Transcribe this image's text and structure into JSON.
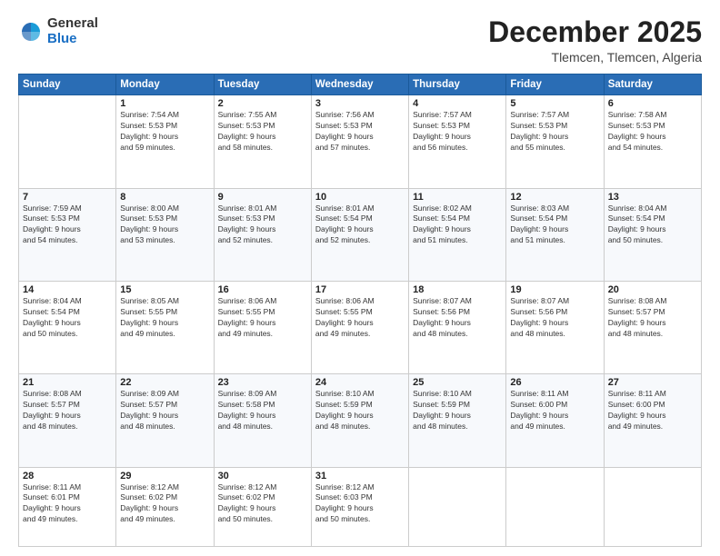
{
  "logo": {
    "general": "General",
    "blue": "Blue"
  },
  "title": {
    "month": "December 2025",
    "location": "Tlemcen, Tlemcen, Algeria"
  },
  "weekdays": [
    "Sunday",
    "Monday",
    "Tuesday",
    "Wednesday",
    "Thursday",
    "Friday",
    "Saturday"
  ],
  "weeks": [
    [
      {
        "day": "",
        "info": ""
      },
      {
        "day": "1",
        "info": "Sunrise: 7:54 AM\nSunset: 5:53 PM\nDaylight: 9 hours\nand 59 minutes."
      },
      {
        "day": "2",
        "info": "Sunrise: 7:55 AM\nSunset: 5:53 PM\nDaylight: 9 hours\nand 58 minutes."
      },
      {
        "day": "3",
        "info": "Sunrise: 7:56 AM\nSunset: 5:53 PM\nDaylight: 9 hours\nand 57 minutes."
      },
      {
        "day": "4",
        "info": "Sunrise: 7:57 AM\nSunset: 5:53 PM\nDaylight: 9 hours\nand 56 minutes."
      },
      {
        "day": "5",
        "info": "Sunrise: 7:57 AM\nSunset: 5:53 PM\nDaylight: 9 hours\nand 55 minutes."
      },
      {
        "day": "6",
        "info": "Sunrise: 7:58 AM\nSunset: 5:53 PM\nDaylight: 9 hours\nand 54 minutes."
      }
    ],
    [
      {
        "day": "7",
        "info": "Sunrise: 7:59 AM\nSunset: 5:53 PM\nDaylight: 9 hours\nand 54 minutes."
      },
      {
        "day": "8",
        "info": "Sunrise: 8:00 AM\nSunset: 5:53 PM\nDaylight: 9 hours\nand 53 minutes."
      },
      {
        "day": "9",
        "info": "Sunrise: 8:01 AM\nSunset: 5:53 PM\nDaylight: 9 hours\nand 52 minutes."
      },
      {
        "day": "10",
        "info": "Sunrise: 8:01 AM\nSunset: 5:54 PM\nDaylight: 9 hours\nand 52 minutes."
      },
      {
        "day": "11",
        "info": "Sunrise: 8:02 AM\nSunset: 5:54 PM\nDaylight: 9 hours\nand 51 minutes."
      },
      {
        "day": "12",
        "info": "Sunrise: 8:03 AM\nSunset: 5:54 PM\nDaylight: 9 hours\nand 51 minutes."
      },
      {
        "day": "13",
        "info": "Sunrise: 8:04 AM\nSunset: 5:54 PM\nDaylight: 9 hours\nand 50 minutes."
      }
    ],
    [
      {
        "day": "14",
        "info": "Sunrise: 8:04 AM\nSunset: 5:54 PM\nDaylight: 9 hours\nand 50 minutes."
      },
      {
        "day": "15",
        "info": "Sunrise: 8:05 AM\nSunset: 5:55 PM\nDaylight: 9 hours\nand 49 minutes."
      },
      {
        "day": "16",
        "info": "Sunrise: 8:06 AM\nSunset: 5:55 PM\nDaylight: 9 hours\nand 49 minutes."
      },
      {
        "day": "17",
        "info": "Sunrise: 8:06 AM\nSunset: 5:55 PM\nDaylight: 9 hours\nand 49 minutes."
      },
      {
        "day": "18",
        "info": "Sunrise: 8:07 AM\nSunset: 5:56 PM\nDaylight: 9 hours\nand 48 minutes."
      },
      {
        "day": "19",
        "info": "Sunrise: 8:07 AM\nSunset: 5:56 PM\nDaylight: 9 hours\nand 48 minutes."
      },
      {
        "day": "20",
        "info": "Sunrise: 8:08 AM\nSunset: 5:57 PM\nDaylight: 9 hours\nand 48 minutes."
      }
    ],
    [
      {
        "day": "21",
        "info": "Sunrise: 8:08 AM\nSunset: 5:57 PM\nDaylight: 9 hours\nand 48 minutes."
      },
      {
        "day": "22",
        "info": "Sunrise: 8:09 AM\nSunset: 5:57 PM\nDaylight: 9 hours\nand 48 minutes."
      },
      {
        "day": "23",
        "info": "Sunrise: 8:09 AM\nSunset: 5:58 PM\nDaylight: 9 hours\nand 48 minutes."
      },
      {
        "day": "24",
        "info": "Sunrise: 8:10 AM\nSunset: 5:59 PM\nDaylight: 9 hours\nand 48 minutes."
      },
      {
        "day": "25",
        "info": "Sunrise: 8:10 AM\nSunset: 5:59 PM\nDaylight: 9 hours\nand 48 minutes."
      },
      {
        "day": "26",
        "info": "Sunrise: 8:11 AM\nSunset: 6:00 PM\nDaylight: 9 hours\nand 49 minutes."
      },
      {
        "day": "27",
        "info": "Sunrise: 8:11 AM\nSunset: 6:00 PM\nDaylight: 9 hours\nand 49 minutes."
      }
    ],
    [
      {
        "day": "28",
        "info": "Sunrise: 8:11 AM\nSunset: 6:01 PM\nDaylight: 9 hours\nand 49 minutes."
      },
      {
        "day": "29",
        "info": "Sunrise: 8:12 AM\nSunset: 6:02 PM\nDaylight: 9 hours\nand 49 minutes."
      },
      {
        "day": "30",
        "info": "Sunrise: 8:12 AM\nSunset: 6:02 PM\nDaylight: 9 hours\nand 50 minutes."
      },
      {
        "day": "31",
        "info": "Sunrise: 8:12 AM\nSunset: 6:03 PM\nDaylight: 9 hours\nand 50 minutes."
      },
      {
        "day": "",
        "info": ""
      },
      {
        "day": "",
        "info": ""
      },
      {
        "day": "",
        "info": ""
      }
    ]
  ]
}
